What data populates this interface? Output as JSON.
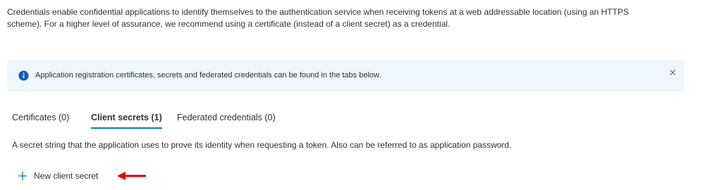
{
  "intro": {
    "text": "Credentials enable confidential applications to identify themselves to the authentication service when receiving tokens at a web addressable location (using an HTTPS scheme). For a higher level of assurance, we recommend using a certificate (instead of a client secret) as a credential."
  },
  "infobar": {
    "icon": "info-icon",
    "text": "Application registration certificates, secrets and federated credentials can be found in the tabs below.",
    "close_icon": "close-icon"
  },
  "tabs": [
    {
      "label": "Certificates (0)",
      "active": false
    },
    {
      "label": "Client secrets (1)",
      "active": true
    },
    {
      "label": "Federated credentials (0)",
      "active": false
    }
  ],
  "tab_description": "A secret string that the application uses to prove its identity when requesting a token. Also can be referred to as application password.",
  "actions": {
    "new_client_secret_label": "New client secret",
    "new_client_secret_icon": "plus-icon"
  },
  "annotation": {
    "icon": "red-arrow-icon",
    "color": "#e00000"
  },
  "colors": {
    "accent": "#0078d4",
    "infobar_bg": "#eff6fc",
    "text": "#323130"
  }
}
